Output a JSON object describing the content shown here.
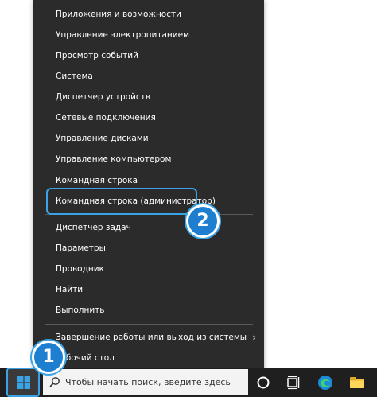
{
  "power_menu": {
    "items": [
      {
        "label": "Приложения и возможности"
      },
      {
        "label": "Управление электропитанием"
      },
      {
        "label": "Просмотр событий"
      },
      {
        "label": "Система"
      },
      {
        "label": "Диспетчер устройств"
      },
      {
        "label": "Сетевые подключения"
      },
      {
        "label": "Управление дисками"
      },
      {
        "label": "Управление компьютером"
      },
      {
        "label": "Командная строка"
      },
      {
        "label": "Командная строка (администратор)"
      },
      {
        "label": "Диспетчер задач"
      },
      {
        "label": "Параметры"
      },
      {
        "label": "Проводник"
      },
      {
        "label": "Найти"
      },
      {
        "label": "Выполнить"
      },
      {
        "label": "Завершение работы или выход из системы"
      },
      {
        "label": "Рабочий стол"
      }
    ],
    "submenu_arrow": "›"
  },
  "annotations": {
    "badge_1": "1",
    "badge_2": "2"
  },
  "taskbar": {
    "search_placeholder": "Чтобы начать поиск, введите здесь",
    "icons": [
      "windows-start-icon",
      "search-icon",
      "cortana-icon",
      "task-view-icon",
      "edge-icon",
      "file-explorer-icon"
    ]
  },
  "colors": {
    "menu_bg": "#2b2b2b",
    "accent_blue": "#3aa3e6",
    "badge_blue": "#1e7fd0",
    "taskbar_bg": "#1f1f1f"
  }
}
